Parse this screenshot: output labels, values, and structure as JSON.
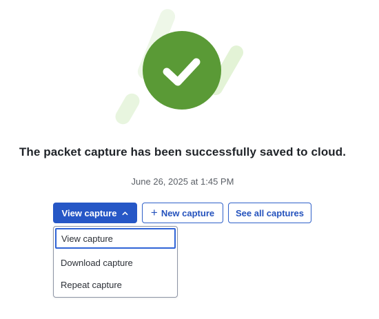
{
  "status": {
    "title": "The packet capture has been successfully saved to cloud.",
    "timestamp": "June 26, 2025 at 1:45 PM"
  },
  "actions": {
    "view_capture_label": "View capture",
    "new_capture_label": "New capture",
    "see_all_label": "See all captures"
  },
  "dropdown": {
    "expanded": true,
    "items": [
      {
        "label": "View capture",
        "focused": true
      },
      {
        "label": "Download capture",
        "focused": false
      },
      {
        "label": "Repeat capture",
        "focused": false
      }
    ]
  },
  "icons": {
    "success": "checkmark-circle-icon",
    "view_dropdown": "chevron-up-icon",
    "new": "plus-icon"
  },
  "colors": {
    "success_green": "#5a9a36",
    "success_accent_light": "#e3f3d6",
    "primary_blue": "#2657c6",
    "outline_blue": "#2d5fc8"
  }
}
